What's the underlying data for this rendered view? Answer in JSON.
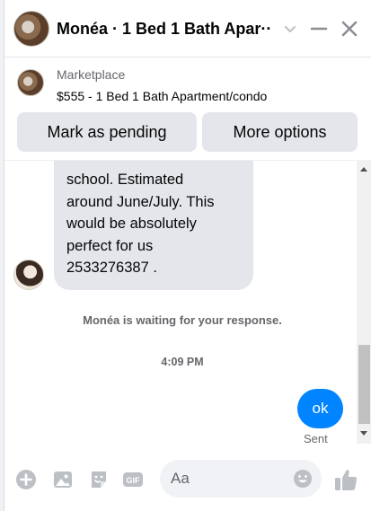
{
  "header": {
    "title": "Monéa · 1 Bed 1 Bath Apar···"
  },
  "listing": {
    "label": "Marketplace",
    "title": "$555 - 1 Bed 1 Bath Apartment/condo"
  },
  "actions": {
    "pending_label": "Mark as pending",
    "more_label": "More options"
  },
  "conversation": {
    "incoming_text": "school. Estimated\naround June/July. This\nwould be absolutely\nperfect for us\n2533276387 .",
    "waiting_text": "Monéa is waiting for your response.",
    "timestamp": "4:09 PM",
    "outgoing_text": "ok",
    "status": "Sent"
  },
  "composer": {
    "placeholder": "Aa"
  },
  "icons": {
    "chevron": "chevron-down-icon",
    "minimize": "minimize-icon",
    "close": "close-icon",
    "plus": "plus-circle-icon",
    "photo": "photo-icon",
    "sticker": "sticker-icon",
    "gif": "gif-icon",
    "emoji": "emoji-icon",
    "like": "thumbs-up-icon"
  },
  "colors": {
    "accent": "#0084ff",
    "icon_gray": "#bcc0c4",
    "bubble_gray": "#e4e6eb"
  }
}
